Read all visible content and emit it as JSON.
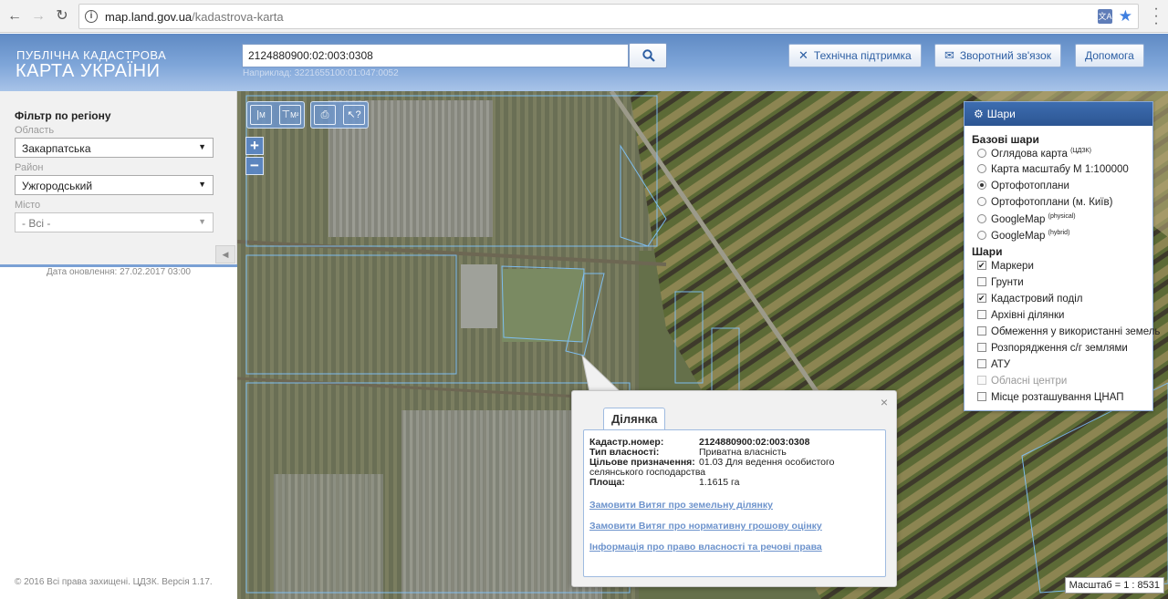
{
  "browser": {
    "url_host": "map.land.gov.ua",
    "url_path": "/kadastrova-karta"
  },
  "header": {
    "brand_line1": "ПУБЛІЧНА КАДАСТРОВА",
    "brand_line2": "КАРТА УКРАЇНИ",
    "search_value": "2124880900:02:003:0308",
    "search_hint": "Наприклад: 3221655100:01:047:0052",
    "support_label": "Технічна підтримка",
    "feedback_label": "Зворотний зв'язок",
    "help_label": "Допомога"
  },
  "sidebar": {
    "filter_title": "Фільтр по регіону",
    "oblast_label": "Область",
    "oblast_value": "Закарпатська",
    "raion_label": "Район",
    "raion_value": "Ужгородський",
    "city_label": "Місто",
    "city_value": "- Всі -",
    "updated": "Дата оновлення: 27.02.2017 03:00",
    "copyright": "© 2016 Всі права захищені. ЦДЗК. Версія 1.17."
  },
  "tools": {
    "measure_m": "M",
    "measure_area": "M²"
  },
  "layers": {
    "title": "Шари",
    "base_title": "Базові шари",
    "base": [
      {
        "label": "Оглядова карта",
        "sup": "(ЦДЗК)",
        "selected": false
      },
      {
        "label": "Карта масштабу М 1:100000",
        "sup": "",
        "selected": false
      },
      {
        "label": "Ортофотоплани",
        "sup": "",
        "selected": true
      },
      {
        "label": "Ортофотоплани (м. Київ)",
        "sup": "",
        "selected": false
      },
      {
        "label": "GoogleMap",
        "sup": "(physical)",
        "selected": false
      },
      {
        "label": "GoogleMap",
        "sup": "(hybrid)",
        "selected": false
      }
    ],
    "overlay_title": "Шари",
    "overlays": [
      {
        "label": "Маркери",
        "checked": true,
        "disabled": false
      },
      {
        "label": "Грунти",
        "checked": false,
        "disabled": false
      },
      {
        "label": "Кадастровий поділ",
        "checked": true,
        "disabled": false
      },
      {
        "label": "Архівні ділянки",
        "checked": false,
        "disabled": false
      },
      {
        "label": "Обмеження у використанні земель",
        "checked": false,
        "disabled": false
      },
      {
        "label": "Розпорядження с/г землями",
        "checked": false,
        "disabled": false
      },
      {
        "label": "АТУ",
        "checked": false,
        "disabled": false
      },
      {
        "label": "Обласні центри",
        "checked": false,
        "disabled": true
      },
      {
        "label": "Місце розташування ЦНАП",
        "checked": false,
        "disabled": false
      }
    ]
  },
  "popup": {
    "tab": "Ділянка",
    "rows": [
      {
        "key": "Кадастр.номер:",
        "value": "2124880900:02:003:0308"
      },
      {
        "key": "Тип власності:",
        "value": "Приватна власність"
      },
      {
        "key": "Цільове призначення:",
        "value": "01.03 Для ведення особистого"
      },
      {
        "key": "",
        "value": "селянського господарства"
      },
      {
        "key": "Площа:",
        "value": "1.1615 га"
      }
    ],
    "links": [
      "Замовити Витяг про земельну ділянку",
      "Замовити Витяг про нормативну грошову оцінку",
      "Інформація про право власності та речові права"
    ]
  },
  "map": {
    "scale_text": "Масштаб = 1 : 8531"
  }
}
